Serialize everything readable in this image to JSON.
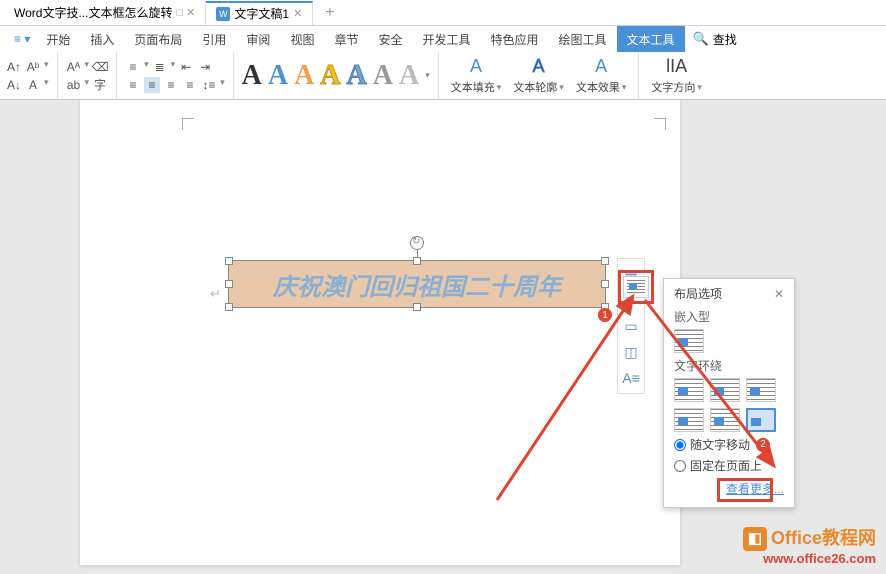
{
  "tabs": {
    "tab1": "Word文字技...文本框怎么旋转",
    "tab2": "文字文稿1",
    "new_tab": "+"
  },
  "ribbon": {
    "tabs": [
      "开始",
      "插入",
      "页面布局",
      "引用",
      "审阅",
      "视图",
      "章节",
      "安全",
      "开发工具",
      "特色应用",
      "绘图工具",
      "文本工具"
    ],
    "search": "查找"
  },
  "wordart": {
    "letter": "A"
  },
  "text_buttons": {
    "fill": "文本填充",
    "outline": "文本轮廓",
    "effect": "文本效果",
    "direction": "文字方向"
  },
  "textbox": {
    "text": "庆祝澳门回归祖国二十周年"
  },
  "layout_panel": {
    "title": "布局选项",
    "inline": "嵌入型",
    "wrap": "文字环绕",
    "radio_move": "随文字移动",
    "radio_fixed": "固定在页面上",
    "more": "查看更多..."
  },
  "badges": {
    "b1": "1",
    "b2": "2"
  },
  "watermark": {
    "line1": "Office教程网",
    "line2": "www.office26.com"
  }
}
